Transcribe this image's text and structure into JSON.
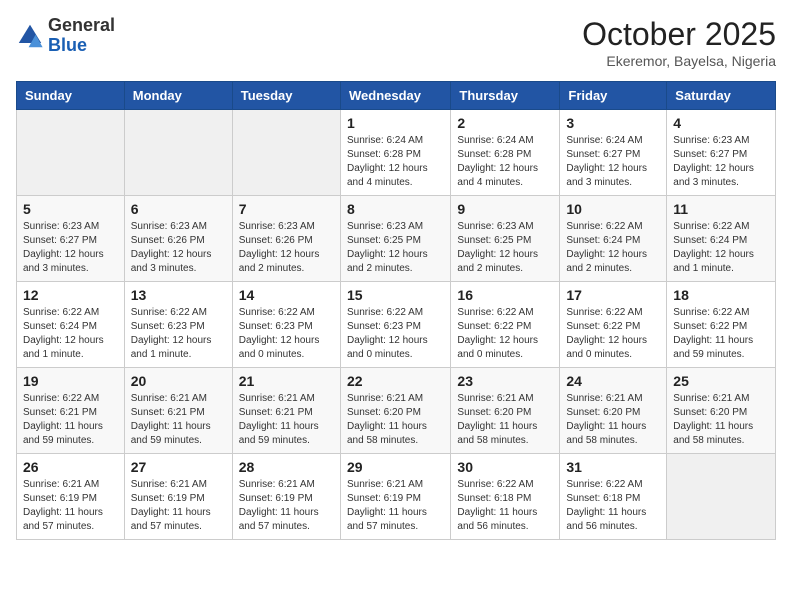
{
  "logo": {
    "general": "General",
    "blue": "Blue"
  },
  "header": {
    "month": "October 2025",
    "location": "Ekeremor, Bayelsa, Nigeria"
  },
  "days_of_week": [
    "Sunday",
    "Monday",
    "Tuesday",
    "Wednesday",
    "Thursday",
    "Friday",
    "Saturday"
  ],
  "weeks": [
    [
      {
        "day": "",
        "info": ""
      },
      {
        "day": "",
        "info": ""
      },
      {
        "day": "",
        "info": ""
      },
      {
        "day": "1",
        "info": "Sunrise: 6:24 AM\nSunset: 6:28 PM\nDaylight: 12 hours and 4 minutes."
      },
      {
        "day": "2",
        "info": "Sunrise: 6:24 AM\nSunset: 6:28 PM\nDaylight: 12 hours and 4 minutes."
      },
      {
        "day": "3",
        "info": "Sunrise: 6:24 AM\nSunset: 6:27 PM\nDaylight: 12 hours and 3 minutes."
      },
      {
        "day": "4",
        "info": "Sunrise: 6:23 AM\nSunset: 6:27 PM\nDaylight: 12 hours and 3 minutes."
      }
    ],
    [
      {
        "day": "5",
        "info": "Sunrise: 6:23 AM\nSunset: 6:27 PM\nDaylight: 12 hours and 3 minutes."
      },
      {
        "day": "6",
        "info": "Sunrise: 6:23 AM\nSunset: 6:26 PM\nDaylight: 12 hours and 3 minutes."
      },
      {
        "day": "7",
        "info": "Sunrise: 6:23 AM\nSunset: 6:26 PM\nDaylight: 12 hours and 2 minutes."
      },
      {
        "day": "8",
        "info": "Sunrise: 6:23 AM\nSunset: 6:25 PM\nDaylight: 12 hours and 2 minutes."
      },
      {
        "day": "9",
        "info": "Sunrise: 6:23 AM\nSunset: 6:25 PM\nDaylight: 12 hours and 2 minutes."
      },
      {
        "day": "10",
        "info": "Sunrise: 6:22 AM\nSunset: 6:24 PM\nDaylight: 12 hours and 2 minutes."
      },
      {
        "day": "11",
        "info": "Sunrise: 6:22 AM\nSunset: 6:24 PM\nDaylight: 12 hours and 1 minute."
      }
    ],
    [
      {
        "day": "12",
        "info": "Sunrise: 6:22 AM\nSunset: 6:24 PM\nDaylight: 12 hours and 1 minute."
      },
      {
        "day": "13",
        "info": "Sunrise: 6:22 AM\nSunset: 6:23 PM\nDaylight: 12 hours and 1 minute."
      },
      {
        "day": "14",
        "info": "Sunrise: 6:22 AM\nSunset: 6:23 PM\nDaylight: 12 hours and 0 minutes."
      },
      {
        "day": "15",
        "info": "Sunrise: 6:22 AM\nSunset: 6:23 PM\nDaylight: 12 hours and 0 minutes."
      },
      {
        "day": "16",
        "info": "Sunrise: 6:22 AM\nSunset: 6:22 PM\nDaylight: 12 hours and 0 minutes."
      },
      {
        "day": "17",
        "info": "Sunrise: 6:22 AM\nSunset: 6:22 PM\nDaylight: 12 hours and 0 minutes."
      },
      {
        "day": "18",
        "info": "Sunrise: 6:22 AM\nSunset: 6:22 PM\nDaylight: 11 hours and 59 minutes."
      }
    ],
    [
      {
        "day": "19",
        "info": "Sunrise: 6:22 AM\nSunset: 6:21 PM\nDaylight: 11 hours and 59 minutes."
      },
      {
        "day": "20",
        "info": "Sunrise: 6:21 AM\nSunset: 6:21 PM\nDaylight: 11 hours and 59 minutes."
      },
      {
        "day": "21",
        "info": "Sunrise: 6:21 AM\nSunset: 6:21 PM\nDaylight: 11 hours and 59 minutes."
      },
      {
        "day": "22",
        "info": "Sunrise: 6:21 AM\nSunset: 6:20 PM\nDaylight: 11 hours and 58 minutes."
      },
      {
        "day": "23",
        "info": "Sunrise: 6:21 AM\nSunset: 6:20 PM\nDaylight: 11 hours and 58 minutes."
      },
      {
        "day": "24",
        "info": "Sunrise: 6:21 AM\nSunset: 6:20 PM\nDaylight: 11 hours and 58 minutes."
      },
      {
        "day": "25",
        "info": "Sunrise: 6:21 AM\nSunset: 6:20 PM\nDaylight: 11 hours and 58 minutes."
      }
    ],
    [
      {
        "day": "26",
        "info": "Sunrise: 6:21 AM\nSunset: 6:19 PM\nDaylight: 11 hours and 57 minutes."
      },
      {
        "day": "27",
        "info": "Sunrise: 6:21 AM\nSunset: 6:19 PM\nDaylight: 11 hours and 57 minutes."
      },
      {
        "day": "28",
        "info": "Sunrise: 6:21 AM\nSunset: 6:19 PM\nDaylight: 11 hours and 57 minutes."
      },
      {
        "day": "29",
        "info": "Sunrise: 6:21 AM\nSunset: 6:19 PM\nDaylight: 11 hours and 57 minutes."
      },
      {
        "day": "30",
        "info": "Sunrise: 6:22 AM\nSunset: 6:18 PM\nDaylight: 11 hours and 56 minutes."
      },
      {
        "day": "31",
        "info": "Sunrise: 6:22 AM\nSunset: 6:18 PM\nDaylight: 11 hours and 56 minutes."
      },
      {
        "day": "",
        "info": ""
      }
    ]
  ]
}
